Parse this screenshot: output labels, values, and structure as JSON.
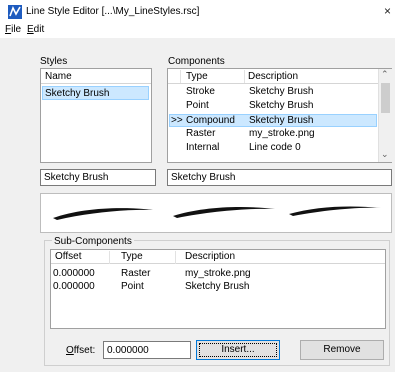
{
  "window": {
    "title": "Line Style Editor [...\\My_LineStyles.rsc]",
    "close_glyph": "×",
    "icon": "line-style-app-icon"
  },
  "menu": {
    "file": {
      "accel": "F",
      "rest": "ile"
    },
    "edit": {
      "accel": "E",
      "rest": "dit"
    }
  },
  "styles": {
    "group_title": "Styles",
    "column_header": "Name",
    "items": [
      "Sketchy Brush"
    ],
    "selected_index": 0,
    "name_value": "Sketchy Brush"
  },
  "components": {
    "group_title": "Components",
    "columns": {
      "type": "Type",
      "description": "Description"
    },
    "rows": [
      {
        "marker": "",
        "type": "Stroke",
        "description": "Sketchy Brush"
      },
      {
        "marker": "",
        "type": "Point",
        "description": "Sketchy Brush"
      },
      {
        "marker": ">>",
        "type": "Compound",
        "description": "Sketchy Brush"
      },
      {
        "marker": "",
        "type": "Raster",
        "description": "my_stroke.png"
      },
      {
        "marker": "",
        "type": "Internal",
        "description": "Line code 0"
      }
    ],
    "selected_index": 2,
    "name_value": "Sketchy Brush",
    "scroll_up_glyph": "⌃",
    "scroll_down_glyph": "⌄"
  },
  "sub_components": {
    "group_title": "Sub-Components",
    "columns": {
      "offset": "Offset",
      "type": "Type",
      "description": "Description"
    },
    "rows": [
      {
        "offset": "0.000000",
        "type": "Raster",
        "description": "my_stroke.png"
      },
      {
        "offset": "0.000000",
        "type": "Point",
        "description": "Sketchy Brush"
      }
    ],
    "offset_label": {
      "accel": "O",
      "rest": "ffset:"
    },
    "offset_value": "0.000000",
    "insert_label": "Insert...",
    "remove_label": "Remove"
  },
  "colors": {
    "selection": "#cce8ff",
    "selection_border": "#99d1ff",
    "dialog_bg": "#f0f0f0",
    "accent": "#0078d7"
  }
}
